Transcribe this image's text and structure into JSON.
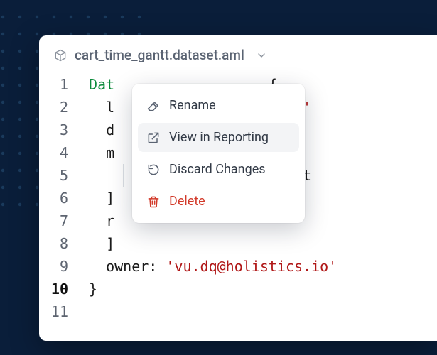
{
  "header": {
    "filename": "cart_time_gantt.dataset.aml"
  },
  "menu": {
    "rename": "Rename",
    "view_reporting": "View in Reporting",
    "discard": "Discard Changes",
    "delete": "Delete"
  },
  "code": {
    "line_numbers": [
      "1",
      "2",
      "3",
      "4",
      "5",
      "6",
      "7",
      "8",
      "9",
      "10",
      "11"
    ],
    "l1_keyword": "Dat",
    "l1_brace": "{",
    "l2_prefix": "  l",
    "l2_suffix": "tt'",
    "l3": "  d",
    "l4": "  m",
    "l5_pad": "    ",
    "l5_suffix": "ntt",
    "l6": "  ]",
    "l7": "  r",
    "l8": "  ]",
    "l9_key": "  owner: ",
    "l9_val": "'vu.dq@holistics.io'",
    "l10": "}"
  }
}
